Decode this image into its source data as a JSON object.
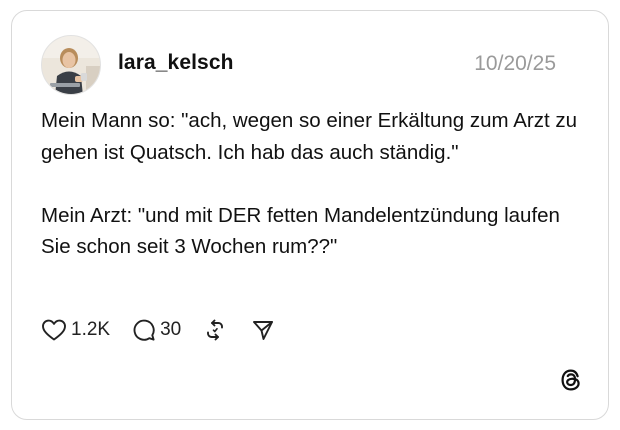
{
  "post": {
    "username": "lara_kelsch",
    "date": "10/20/25",
    "paragraphs": [
      "Mein Mann so: \"ach, wegen so einer Erkältung zum Arzt zu gehen ist Quatsch. Ich hab das auch ständig.\"",
      "Mein Arzt: \"und mit DER fetten Mandelentzündung laufen Sie schon seit 3 Wochen rum??\""
    ]
  },
  "actions": {
    "likes": "1.2K",
    "replies": "30"
  },
  "icons": {
    "like": "heart-icon",
    "reply": "comment-icon",
    "repost": "repost-icon",
    "share": "send-icon",
    "brand": "threads-logo-icon"
  },
  "colors": {
    "text": "#111111",
    "date": "#9a9a9a",
    "border": "#d9d9d9"
  }
}
